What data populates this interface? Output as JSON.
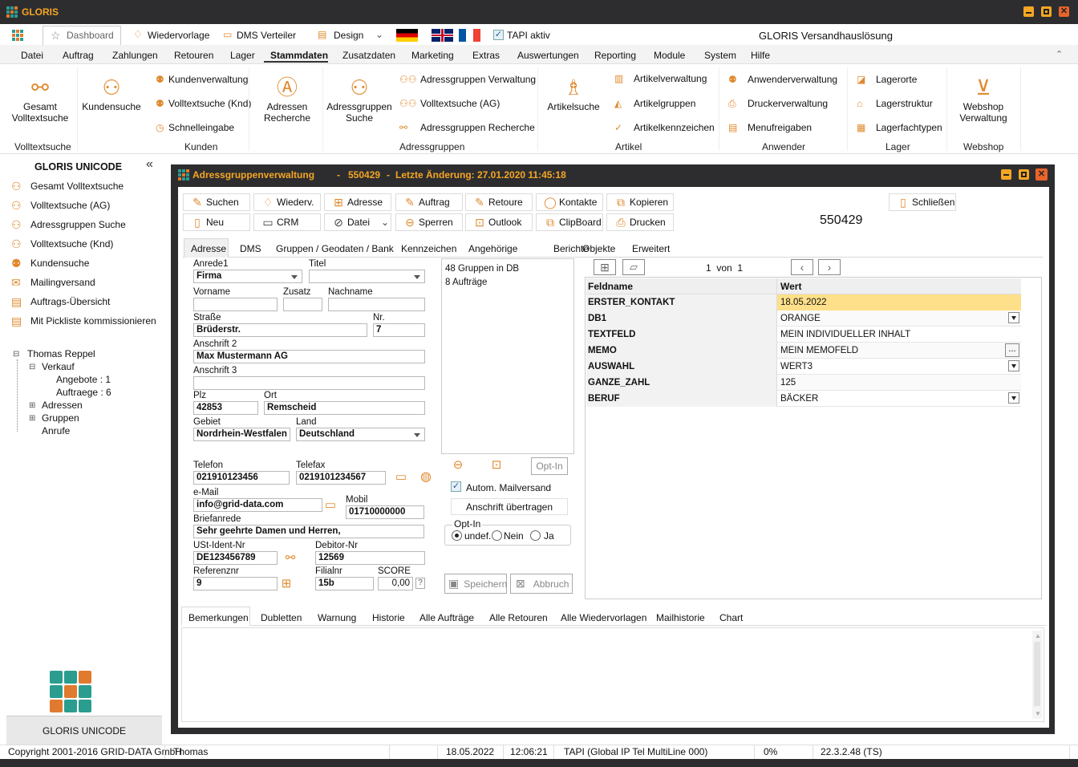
{
  "app": {
    "title": "GLORIS",
    "tagline": "GLORIS Versandhauslösung"
  },
  "quickbar": {
    "dashboard": "Dashboard",
    "wiedervorlage": "Wiedervorlage",
    "dms": "DMS Verteiler",
    "design": "Design",
    "tapi": "TAPI aktiv"
  },
  "menu": [
    "Datei",
    "Auftrag",
    "Zahlungen",
    "Retouren",
    "Lager",
    "Stammdaten",
    "Zusatzdaten",
    "Marketing",
    "Extras",
    "Auswertungen",
    "Reporting",
    "Module",
    "System",
    "Hilfe"
  ],
  "ribbon": {
    "gesamt": "Gesamt\nVolltextsuche",
    "kundensuche": "Kundensuche",
    "kundenverwaltung": "Kundenverwaltung",
    "volltext_knd": "Volltextsuche (Knd)",
    "schnelleingabe": "Schnelleingabe",
    "adressen_recherche": "Adressen\nRecherche",
    "ag_suche": "Adressgruppen\nSuche",
    "ag_verwaltung": "Adressgruppen Verwaltung",
    "volltext_ag": "Volltextsuche (AG)",
    "ag_recherche": "Adressgruppen Recherche",
    "artikelsuche": "Artikelsuche",
    "artikelverwaltung": "Artikelverwaltung",
    "artikelgruppen": "Artikelgruppen",
    "artikelkennzeichen": "Artikelkennzeichen",
    "anwenderverwaltung": "Anwenderverwaltung",
    "druckerverwaltung": "Druckerverwaltung",
    "menufreigaben": "Menufreigaben",
    "lagerorte": "Lagerorte",
    "lagerstruktur": "Lagerstruktur",
    "lagerfachtypen": "Lagerfachtypen",
    "webshop": "Webshop\nVerwaltung",
    "groups": [
      "Volltextsuche",
      "Kunden",
      "Adressgruppen",
      "Artikel",
      "Anwender",
      "Lager",
      "Webshop"
    ]
  },
  "sidebar": {
    "title": "GLORIS UNICODE",
    "items": [
      "Gesamt Volltextsuche",
      "Volltextsuche (AG)",
      "Adressgruppen Suche",
      "Volltextsuche (Knd)",
      "Kundensuche",
      "Mailingversand",
      "Auftrags-Übersicht",
      "Mit Pickliste kommissionieren"
    ],
    "tree": {
      "user": "Thomas Reppel",
      "verkauf": "Verkauf",
      "angebote": "Angebote : 1",
      "auftraege": "Auftraege : 6",
      "adressen": "Adressen",
      "gruppen": "Gruppen",
      "anrufe": "Anrufe"
    },
    "footer": "GLORIS UNICODE"
  },
  "window": {
    "title": "Adressgruppenverwaltung",
    "id": "550429",
    "change": "Letzte Änderung: 27.01.2020 11:45:18"
  },
  "toolbar": {
    "suchen": "Suchen",
    "wiederv": "Wiederv.",
    "adresse": "Adresse",
    "auftrag": "Auftrag",
    "retoure": "Retoure",
    "kontakte": "Kontakte",
    "kopieren": "Kopieren",
    "schliessen": "Schließen",
    "neu": "Neu",
    "crm": "CRM",
    "datei": "Datei",
    "sperren": "Sperren",
    "outlook": "Outlook",
    "clipboard": "ClipBoard",
    "drucken": "Drucken",
    "record_no": "550429"
  },
  "tabs": [
    "Adresse",
    "DMS",
    "Gruppen / Geodaten / Bank",
    "Kennzeichen",
    "Angehörige",
    "Berichte",
    "Objekte",
    "Erweitert"
  ],
  "form": {
    "anrede_l": "Anrede1",
    "anrede": "Firma",
    "titel_l": "Titel",
    "titel": "",
    "vorname_l": "Vorname",
    "zusatz_l": "Zusatz",
    "nachname_l": "Nachname",
    "strasse_l": "Straße",
    "strasse": "Brüderstr.",
    "nr_l": "Nr.",
    "nr": "7",
    "anschrift2_l": "Anschrift 2",
    "anschrift2": "Max Mustermann AG",
    "anschrift3_l": "Anschrift 3",
    "plz_l": "Plz",
    "plz": "42853",
    "ort_l": "Ort",
    "ort": "Remscheid",
    "gebiet_l": "Gebiet",
    "gebiet": "Nordrhein-Westfalen",
    "land_l": "Land",
    "land": "Deutschland",
    "telefon_l": "Telefon",
    "telefon": "021910123456",
    "telefax_l": "Telefax",
    "telefax": "0219101234567",
    "email_l": "e-Mail",
    "email": "info@grid-data.com",
    "mobil_l": "Mobil",
    "mobil": "01710000000",
    "brief_l": "Briefanrede",
    "brief": "Sehr geehrte Damen und Herren,",
    "ust_l": "USt-Ident-Nr",
    "ust": "DE123456789",
    "debitor_l": "Debitor-Nr",
    "debitor": "12569",
    "ref_l": "Referenznr",
    "ref": "9",
    "filial_l": "Filialnr",
    "filial": "15b",
    "score_l": "SCORE",
    "score": "0,00",
    "q": "?"
  },
  "info": {
    "gruppen": "48 Gruppen in DB",
    "auftraege": "8 Aufträge",
    "optin_btn": "Opt-In",
    "automail": "Autom. Mailversand",
    "anschrift_btn": "Anschrift übertragen",
    "optin_group": "Opt-In",
    "undef": "undef.",
    "nein": "Nein",
    "ja": "Ja",
    "speichern": "Speichern",
    "abbruch": "Abbruch"
  },
  "grid": {
    "pager": "1  von  1",
    "h_name": "Feldname",
    "h_value": "Wert",
    "rows": [
      {
        "k": "ERSTER_KONTAKT",
        "v": "18.05.2022"
      },
      {
        "k": "DB1",
        "v": "ORANGE"
      },
      {
        "k": "TEXTFELD",
        "v": "MEIN INDIVIDUELLER INHALT"
      },
      {
        "k": "MEMO",
        "v": "MEIN MEMOFELD"
      },
      {
        "k": "AUSWAHL",
        "v": "WERT3"
      },
      {
        "k": "GANZE_ZAHL",
        "v": "125"
      },
      {
        "k": "BERUF",
        "v": "BÄCKER"
      }
    ],
    "ellipsis": "..."
  },
  "btabs": [
    "Bemerkungen",
    "Dubletten",
    "Warnung",
    "Historie",
    "Alle Aufträge",
    "Alle Retouren",
    "Alle Wiedervorlagen",
    "Mailhistorie",
    "Chart"
  ],
  "status": {
    "copyright": "Copyright 2001-2016 GRID-DATA GmbH",
    "user": "Thomas",
    "date": "18.05.2022",
    "time": "12:06:21",
    "tapi": "TAPI (Global IP Tel MultiLine 000)",
    "pct": "0%",
    "version": "22.3.2.48 (TS)"
  },
  "colors": {
    "titlebar": "#2d2d30",
    "accent": "#f5a623",
    "icon": "#e08a2e",
    "highlight": "#ffe08a"
  }
}
